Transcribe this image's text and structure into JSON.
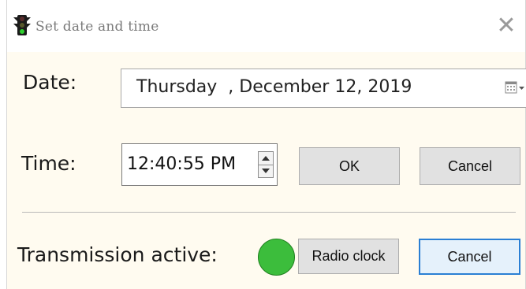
{
  "window": {
    "title": "Set date and time",
    "close_symbol": "✕",
    "icon": "traffic-light-icon"
  },
  "date": {
    "label": "Date:",
    "weekday": "Thursday",
    "value": "Thursday  , December 12, 2019",
    "dropdown_icon": "calendar-icon"
  },
  "time": {
    "label": "Time:",
    "value": "12:40:55 PM",
    "spinner_icons": [
      "triangle-up-icon",
      "triangle-down-icon"
    ]
  },
  "buttons": {
    "ok": "OK",
    "cancel_top": "Cancel",
    "radio_clock": "Radio clock",
    "cancel_bottom": "Cancel"
  },
  "transmission": {
    "label": "Transmission active:",
    "indicator_color": "#3cbd3c",
    "active": true
  },
  "colors": {
    "background": "#fffbf0",
    "default_button_border": "#2a7fd4"
  }
}
